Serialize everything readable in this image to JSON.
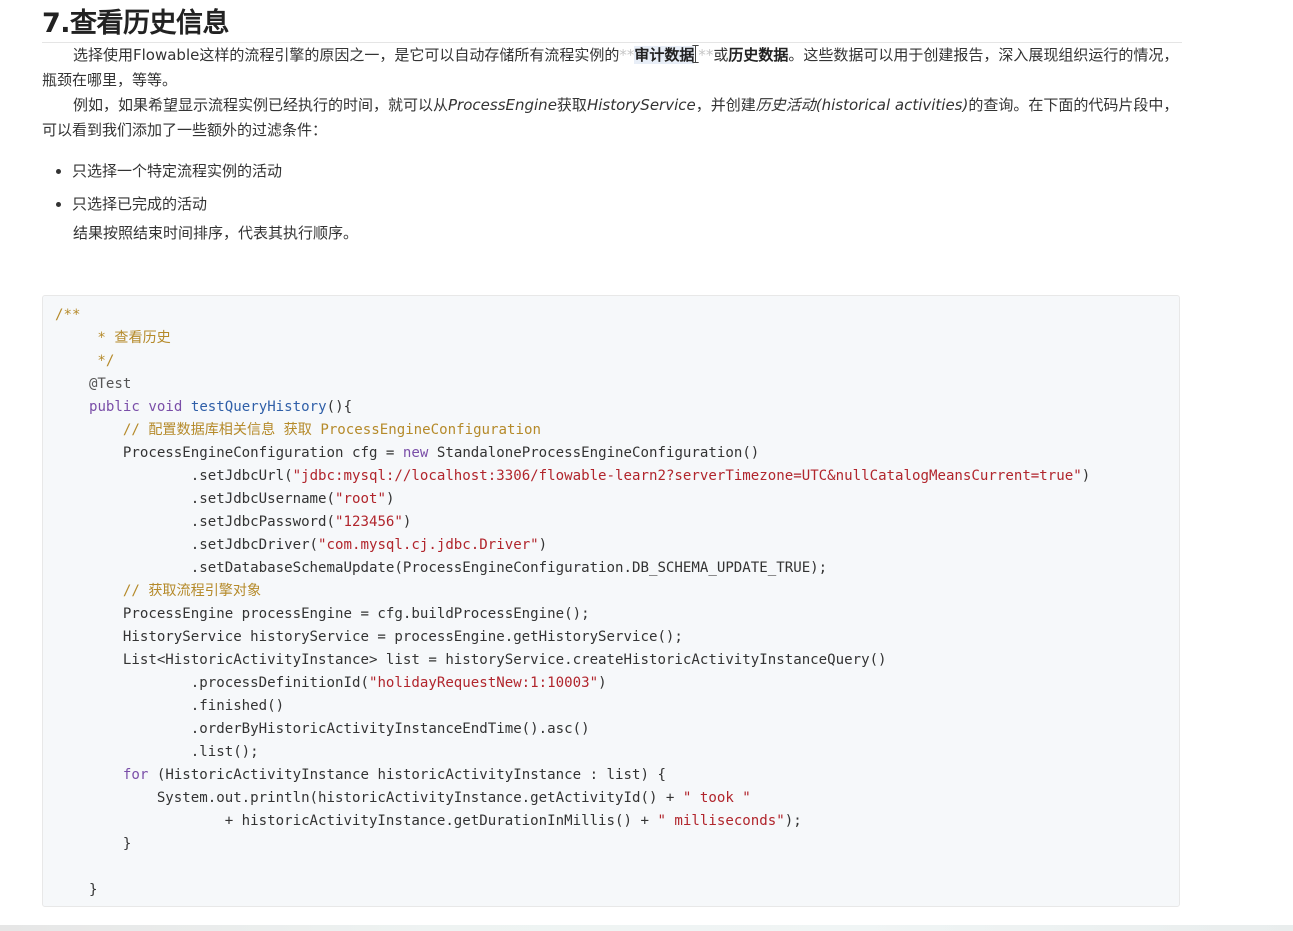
{
  "heading": "7.查看历史信息",
  "p1": {
    "a": "选择使用Flowable这样的流程引擎的原因之一，是它可以自动存储所有流程实例的",
    "m1": "**",
    "b": "审计数据",
    "m2": "**",
    "c": "或",
    "d": "历史数据",
    "e": "。这些数据可以用于创建报告，深入展现组织运行的情况，瓶颈在哪里，等等。"
  },
  "p2": {
    "a": "例如，如果希望显示流程实例已经执行的时间，就可以从",
    "b": "ProcessEngine",
    "c": "获取",
    "d": "HistoryService",
    "e": "，并创建",
    "f": "历史活动(historical activities)",
    "g": "的查询。在下面的代码片段中，可以看到我们添加了一些额外的过滤条件："
  },
  "bullets": [
    "只选择一个特定流程实例的活动",
    "只选择已完成的活动"
  ],
  "p3": "结果按照结束时间排序，代表其执行顺序。",
  "code": {
    "l1": "/**",
    "l2": "     * 查看历史",
    "l3": "     */",
    "l4": "    @Test",
    "l5_kw1": "public",
    "l5_kw2": "void",
    "l5_fn": "testQueryHistory",
    "l5_rest": "(){",
    "l6": "        // 配置数据库相关信息 获取 ProcessEngineConfiguration",
    "l7_a": "        ProcessEngineConfiguration cfg = ",
    "l7_kw": "new",
    "l7_b": " StandaloneProcessEngineConfiguration()",
    "l8_a": "                .setJdbcUrl(",
    "l8_str": "\"jdbc:mysql://localhost:3306/flowable-learn2?serverTimezone=UTC&nullCatalogMeansCurrent=true\"",
    "l8_b": ")",
    "l9_a": "                .setJdbcUsername(",
    "l9_str": "\"root\"",
    "l9_b": ")",
    "l10_a": "                .setJdbcPassword(",
    "l10_str": "\"123456\"",
    "l10_b": ")",
    "l11_a": "                .setJdbcDriver(",
    "l11_str": "\"com.mysql.cj.jdbc.Driver\"",
    "l11_b": ")",
    "l12": "                .setDatabaseSchemaUpdate(ProcessEngineConfiguration.DB_SCHEMA_UPDATE_TRUE);",
    "l13": "        // 获取流程引擎对象",
    "l14": "        ProcessEngine processEngine = cfg.buildProcessEngine();",
    "l15": "        HistoryService historyService = processEngine.getHistoryService();",
    "l16": "        List<HistoricActivityInstance> list = historyService.createHistoricActivityInstanceQuery()",
    "l17_a": "                .processDefinitionId(",
    "l17_str": "\"holidayRequestNew:1:10003\"",
    "l17_b": ")",
    "l18": "                .finished()",
    "l19": "                .orderByHistoricActivityInstanceEndTime().asc()",
    "l20": "                .list();",
    "l21_kw": "for",
    "l21_b": " (HistoricActivityInstance historicActivityInstance : list) {",
    "l22_a": "            System.out.println(historicActivityInstance.getActivityId() + ",
    "l22_str": "\" took \"",
    "l23_a": "                    + historicActivityInstance.getDurationInMillis() + ",
    "l23_str": "\" milliseconds\"",
    "l23_b": ");",
    "l24": "        }",
    "l25": "",
    "l26": "    }"
  }
}
